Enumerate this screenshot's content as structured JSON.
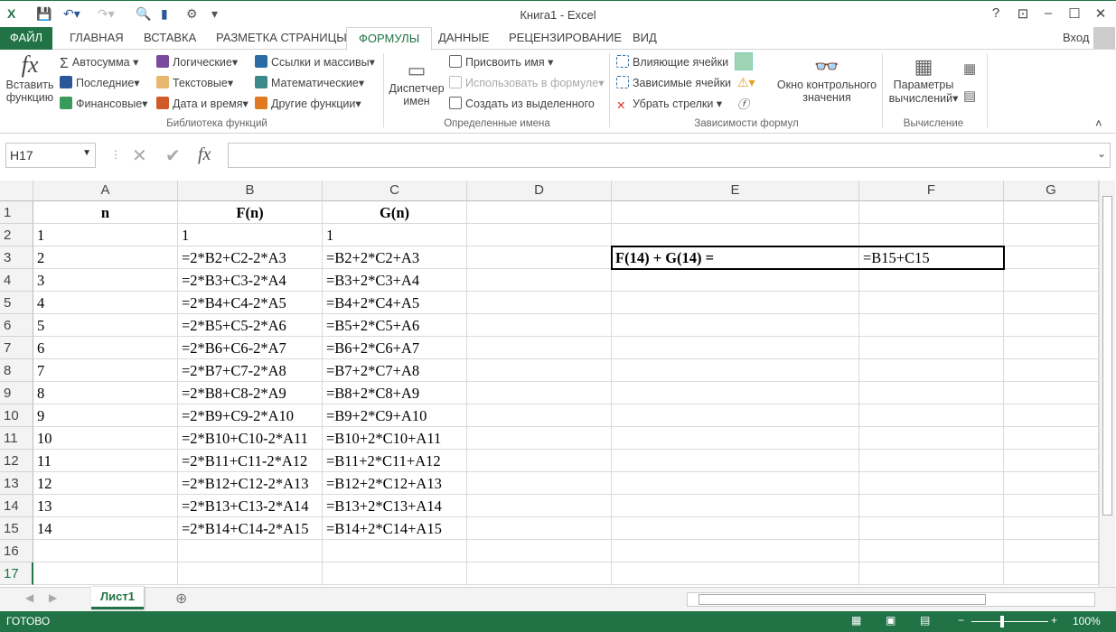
{
  "window": {
    "title": "Книга1 - Excel",
    "help": "?",
    "signin": "Вход"
  },
  "tabs": [
    "ФАЙЛ",
    "ГЛАВНАЯ",
    "ВСТАВКА",
    "РАЗМЕТКА СТРАНИЦЫ",
    "ФОРМУЛЫ",
    "ДАННЫЕ",
    "РЕЦЕНЗИРОВАНИЕ",
    "ВИД"
  ],
  "ribbon": {
    "insert_fn": [
      "Вставить",
      "функцию"
    ],
    "lib": [
      "Автосумма",
      "Последние",
      "Финансовые",
      "Логические",
      "Текстовые",
      "Дата и время",
      "Ссылки и массивы",
      "Математические",
      "Другие функции"
    ],
    "lib_group": "Библиотека функций",
    "name_mgr": [
      "Диспетчер",
      "имен"
    ],
    "names": [
      "Присвоить имя",
      "Использовать в формуле",
      "Создать из выделенного"
    ],
    "names_group": "Определенные имена",
    "deps": [
      "Влияющие ячейки",
      "Зависимые ячейки",
      "Убрать стрелки"
    ],
    "watch": [
      "Окно контрольного",
      "значения"
    ],
    "deps_group": "Зависимости формул",
    "calc": [
      "Параметры",
      "вычислений"
    ],
    "calc_group": "Вычисление"
  },
  "formula_bar": {
    "name_box": "H17",
    "formula": ""
  },
  "columns": [
    "A",
    "B",
    "C",
    "D",
    "E",
    "F",
    "G"
  ],
  "rows": [
    [
      "n",
      "F(n)",
      "G(n)"
    ],
    [
      "1",
      "1",
      "1"
    ],
    [
      "2",
      "=2*B2+C2-2*A3",
      "=B2+2*C2+A3"
    ],
    [
      "3",
      "=2*B3+C3-2*A4",
      "=B3+2*C3+A4"
    ],
    [
      "4",
      "=2*B4+C4-2*A5",
      "=B4+2*C4+A5"
    ],
    [
      "5",
      "=2*B5+C5-2*A6",
      "=B5+2*C5+A6"
    ],
    [
      "6",
      "=2*B6+C6-2*A7",
      "=B6+2*C6+A7"
    ],
    [
      "7",
      "=2*B7+C7-2*A8",
      "=B7+2*C7+A8"
    ],
    [
      "8",
      "=2*B8+C8-2*A9",
      "=B8+2*C8+A9"
    ],
    [
      "9",
      "=2*B9+C9-2*A10",
      "=B9+2*C9+A10"
    ],
    [
      "10",
      "=2*B10+C10-2*A11",
      "=B10+2*C10+A11"
    ],
    [
      "11",
      "=2*B11+C11-2*A12",
      "=B11+2*C11+A12"
    ],
    [
      "12",
      "=2*B12+C12-2*A13",
      "=B12+2*C12+A13"
    ],
    [
      "13",
      "=2*B13+C13-2*A14",
      "=B13+2*C13+A14"
    ],
    [
      "14",
      "=2*B14+C14-2*A15",
      "=B14+2*C14+A15"
    ],
    [
      "",
      "",
      " "
    ],
    [
      "",
      "",
      ""
    ]
  ],
  "e3": "F(14) + G(14) =",
  "f3": "=B15+C15",
  "sheet": "Лист1",
  "status": {
    "ready": "ГОТОВО",
    "zoom": "100%"
  },
  "colors": {
    "accent": "#217346"
  }
}
